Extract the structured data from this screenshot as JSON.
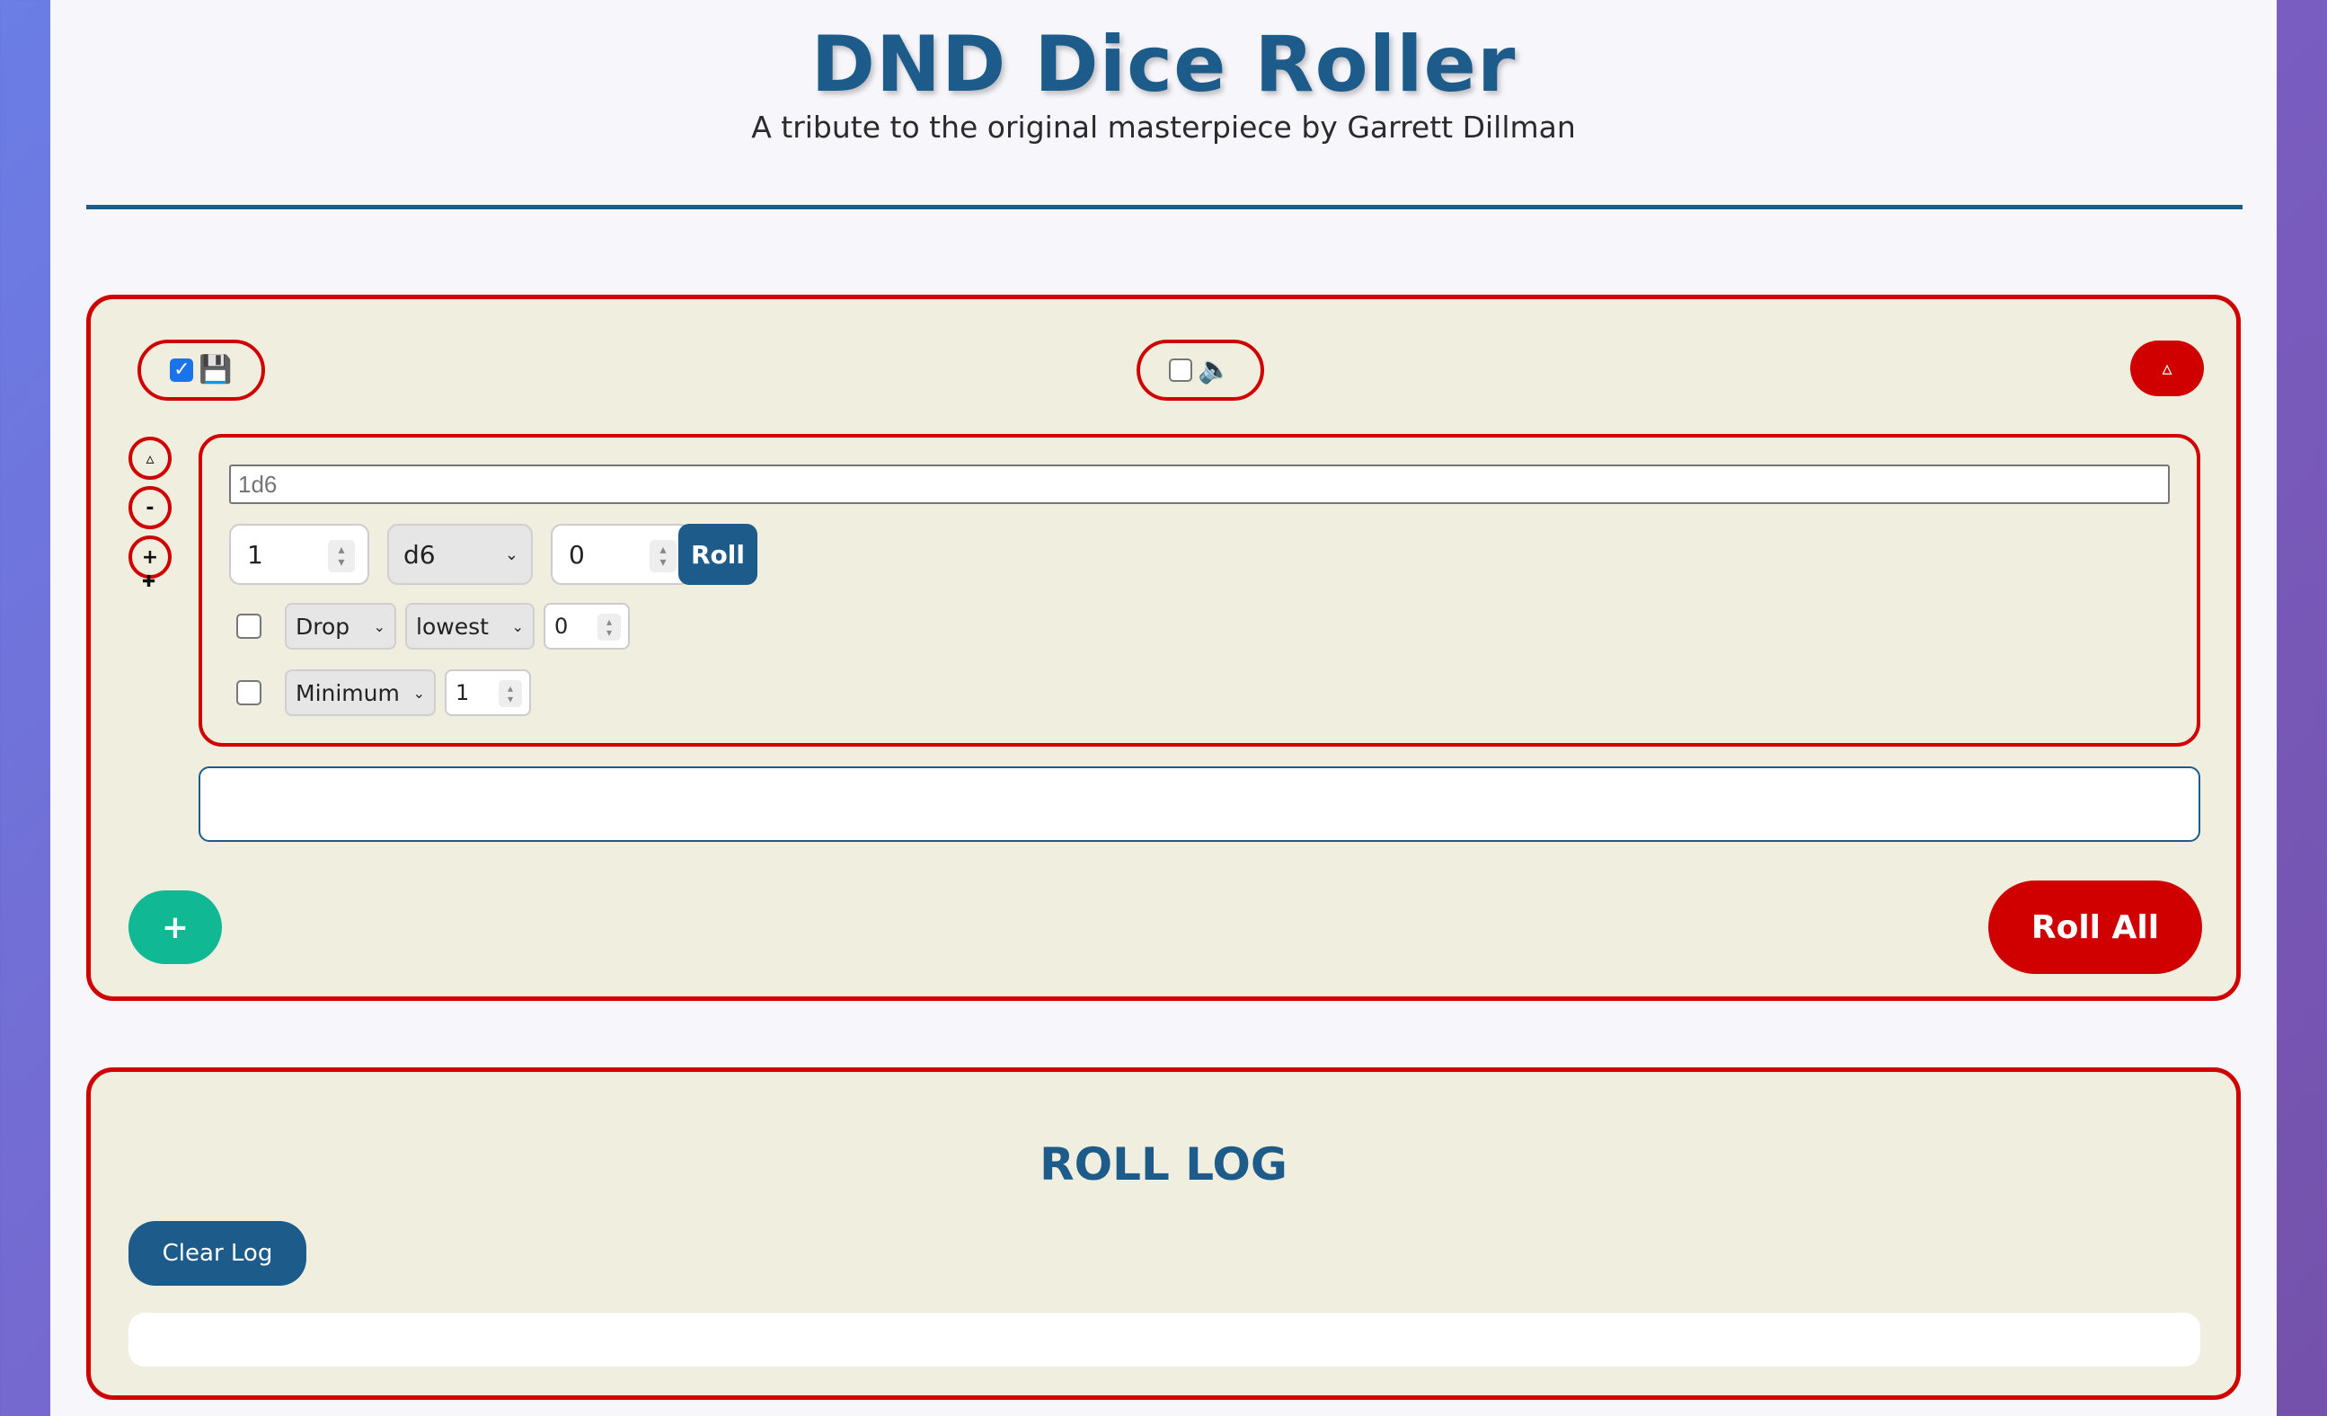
{
  "header": {
    "title": "DND Dice Roller",
    "subtitle": "A tribute to the original masterpiece by Garrett Dillman"
  },
  "toolbar": {
    "save_toggle": {
      "checked": true,
      "icon": "floppy-disk-icon",
      "glyph": "💾"
    },
    "sound_toggle": {
      "checked": false,
      "icon": "speaker-mute-icon",
      "glyph": "🔈"
    },
    "collapse_glyph": "▵"
  },
  "side_controls": {
    "up": "▵",
    "remove": "-",
    "add": "+",
    "drag": "✚"
  },
  "dice_group": {
    "formula_placeholder": "1d6",
    "count": "1",
    "die_type": "d6",
    "modifier": "0",
    "roll_label": "Roll",
    "drop_option": {
      "enabled": false,
      "mode": "Drop",
      "which": "lowest",
      "amount": "0"
    },
    "minimum_option": {
      "enabled": false,
      "mode": "Minimum",
      "amount": "1"
    }
  },
  "actions": {
    "add_label": "+",
    "roll_all_label": "Roll All"
  },
  "roll_log": {
    "title": "ROLL LOG",
    "clear_label": "Clear Log"
  },
  "colors": {
    "accent_blue": "#1d5c8a",
    "accent_red": "#d00000",
    "accent_green": "#10b894",
    "panel_bg": "#efeedf"
  }
}
